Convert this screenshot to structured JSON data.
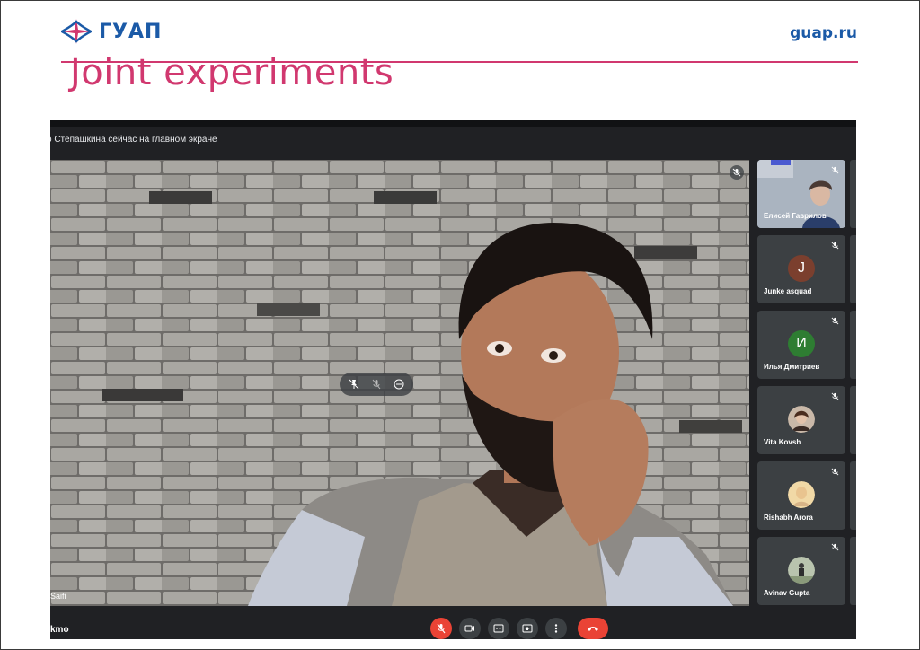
{
  "slide": {
    "logo_text": "ГУАП",
    "site": "guap.ru",
    "title": "Joint experiments"
  },
  "meet": {
    "notice": "о Степашкина сейчас на главном экране",
    "main_speaker_name": "Saifi",
    "meeting_code": "kmo",
    "participants": [
      {
        "name": "Елисей Гаврилов",
        "type": "video",
        "muted": true
      },
      {
        "name": "Junke asquad",
        "initial": "J",
        "avatar_color": "#7b3f2e",
        "muted": true
      },
      {
        "name": "Илья Дмитриев",
        "initial": "И",
        "avatar_color": "#2e7d32",
        "muted": true
      },
      {
        "name": "Vita Kovsh",
        "type": "photo",
        "muted": true
      },
      {
        "name": "Rishabh Arora",
        "type": "photo",
        "muted": true
      },
      {
        "name": "Avinav Gupta",
        "type": "photo",
        "muted": true
      }
    ],
    "controls": [
      {
        "icon": "mic-off-icon"
      },
      {
        "icon": "camera-icon"
      },
      {
        "icon": "captions-icon"
      },
      {
        "icon": "present-icon"
      },
      {
        "icon": "more-vert-icon"
      },
      {
        "icon": "hang-up-icon"
      }
    ],
    "colors": {
      "background": "#202124",
      "tile": "#3c4043",
      "danger": "#ea4335"
    }
  }
}
